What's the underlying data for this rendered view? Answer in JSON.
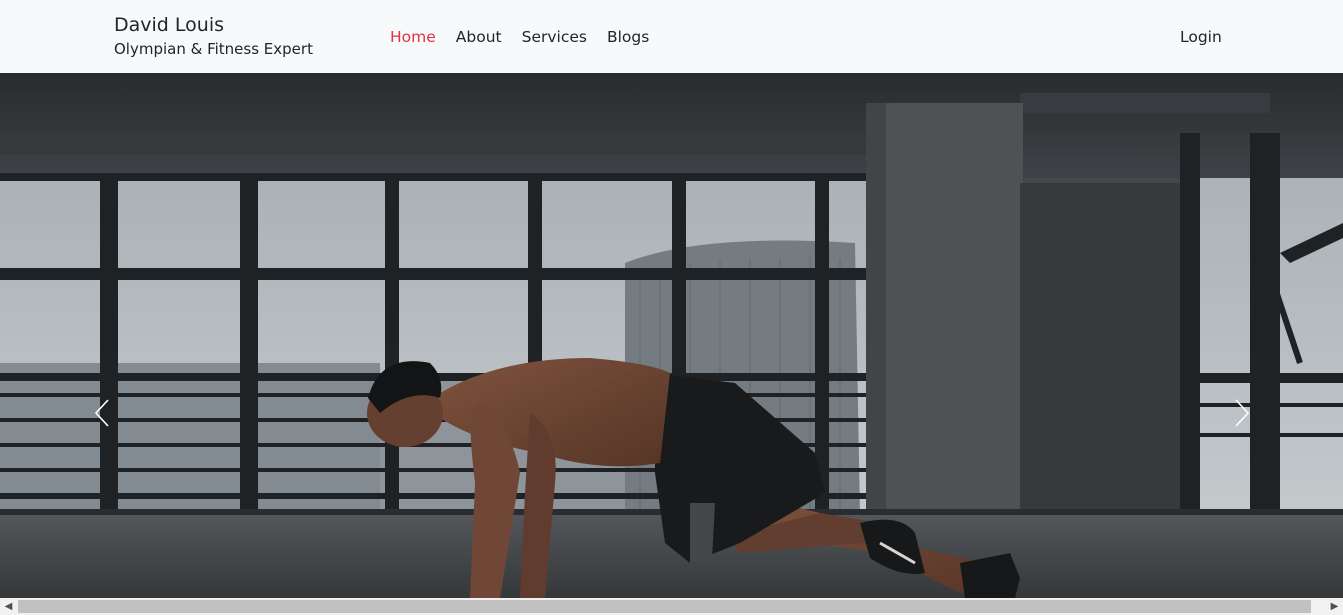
{
  "brand": {
    "name": "David Louis",
    "tagline": "Olympian & Fitness Expert"
  },
  "nav": {
    "items": [
      {
        "label": "Home",
        "active": true
      },
      {
        "label": "About"
      },
      {
        "label": "Services"
      },
      {
        "label": "Blogs"
      }
    ],
    "login_label": "Login"
  },
  "colors": {
    "accent": "#dc3545",
    "text": "#212529",
    "navbar_bg": "#f8f9fa"
  },
  "hero": {
    "image": "photo of a man doing mountain climbers in an empty industrial gym with large windows",
    "prev_icon": "chevron-left-icon",
    "next_icon": "chevron-right-icon"
  },
  "scrollbar": {
    "left_icon": "arrow-left-icon",
    "right_icon": "arrow-right-icon"
  }
}
